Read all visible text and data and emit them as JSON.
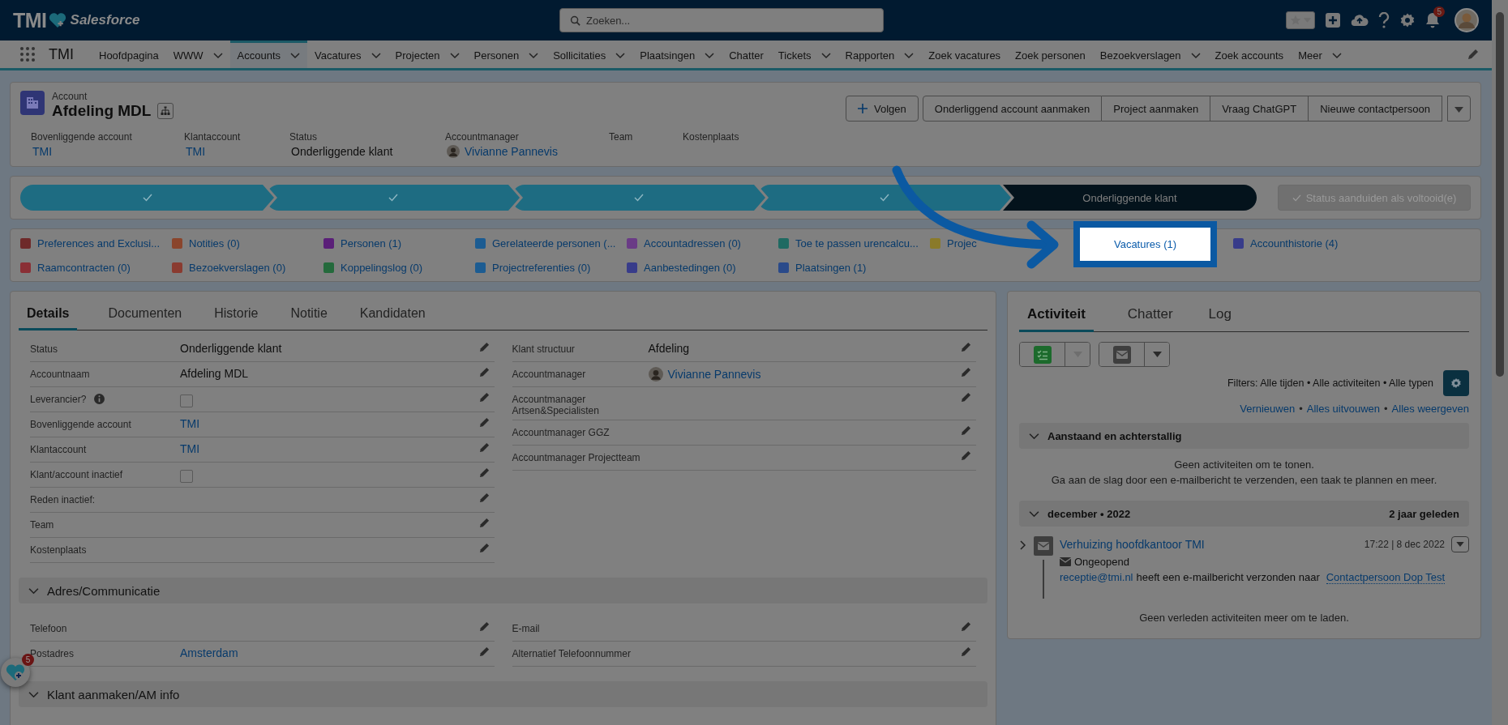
{
  "header": {
    "logo_text": "TMI",
    "brand": "Salesforce",
    "search": {
      "placeholder": "Zoeken..."
    },
    "notifications": "5"
  },
  "nav": {
    "app_name": "TMI",
    "items": [
      {
        "label": "Hoofdpagina",
        "dropdown": false,
        "selected": false
      },
      {
        "label": "WWW",
        "dropdown": true,
        "selected": false
      },
      {
        "label": "Accounts",
        "dropdown": true,
        "selected": true
      },
      {
        "label": "Vacatures",
        "dropdown": true,
        "selected": false
      },
      {
        "label": "Projecten",
        "dropdown": true,
        "selected": false
      },
      {
        "label": "Personen",
        "dropdown": true,
        "selected": false
      },
      {
        "label": "Sollicitaties",
        "dropdown": true,
        "selected": false
      },
      {
        "label": "Plaatsingen",
        "dropdown": true,
        "selected": false
      },
      {
        "label": "Chatter",
        "dropdown": false,
        "selected": false
      },
      {
        "label": "Tickets",
        "dropdown": true,
        "selected": false
      },
      {
        "label": "Rapporten",
        "dropdown": true,
        "selected": false
      },
      {
        "label": "Zoek vacatures",
        "dropdown": false,
        "selected": false
      },
      {
        "label": "Zoek personen",
        "dropdown": false,
        "selected": false
      },
      {
        "label": "Bezoekverslagen",
        "dropdown": true,
        "selected": false
      },
      {
        "label": "Zoek accounts",
        "dropdown": false,
        "selected": false
      },
      {
        "label": "Meer",
        "dropdown": true,
        "selected": false
      }
    ]
  },
  "record": {
    "object": "Account",
    "name": "Afdeling MDL",
    "actions": [
      {
        "kind": "follow",
        "label": "Volgen"
      },
      {
        "kind": "text",
        "label": "Onderliggend account aanmaken"
      },
      {
        "kind": "text",
        "label": "Project aanmaken"
      },
      {
        "kind": "text",
        "label": "Vraag ChatGPT"
      },
      {
        "kind": "text",
        "label": "Nieuwe contactpersoon"
      },
      {
        "kind": "menu"
      }
    ],
    "highlights": [
      {
        "label": "Bovenliggende account",
        "kind": "link",
        "value": "TMI"
      },
      {
        "label": "Klantaccount",
        "kind": "link",
        "value": "TMI"
      },
      {
        "label": "Status",
        "kind": "text",
        "value": "Onderliggende klant"
      },
      {
        "label": "Accountmanager",
        "kind": "user",
        "value": "Vivianne Pannevis"
      },
      {
        "label": "Team"
      },
      {
        "label": "Kostenplaats"
      }
    ]
  },
  "path": {
    "stages": [
      {
        "completed": true
      },
      {
        "completed": true
      },
      {
        "completed": true
      },
      {
        "completed": true
      },
      {
        "completed": false,
        "label": "Onderliggende klant"
      }
    ],
    "button": {
      "label": "Status aanduiden als voltooid(e)",
      "disabled": true
    }
  },
  "related": {
    "items": [
      {
        "label": "Preferences and Exclusi...",
        "color": "#6e2a2a",
        "highlighted": false
      },
      {
        "label": "Notities (0)",
        "color": "#8a452c",
        "highlighted": false
      },
      {
        "label": "Personen (1)",
        "color": "#5a1f78",
        "highlighted": false
      },
      {
        "label": "Gerelateerde personen (...",
        "color": "#1c5c92",
        "highlighted": false
      },
      {
        "label": "Accountadressen (0)",
        "color": "#6a3b86",
        "highlighted": false
      },
      {
        "label": "Toe te passen urencalcu...",
        "color": "#1f6a62",
        "highlighted": false
      },
      {
        "label": "Projec",
        "color": "#8a7a2a",
        "highlighted": false
      },
      {
        "label": "Vacatures (1)",
        "highlighted": true
      },
      {
        "label": "Accounthistorie (4)",
        "color": "#383c8a",
        "highlighted": false
      },
      {
        "label": "Raamcontracten (0)",
        "color": "#8a2f35",
        "highlighted": false
      },
      {
        "label": "Bezoekverslagen (0)",
        "color": "#8a3b30",
        "highlighted": false
      },
      {
        "label": "Koppelingslog (0)",
        "color": "#246a3c",
        "highlighted": false
      },
      {
        "label": "Projectreferenties (0)",
        "color": "#1c5c92",
        "highlighted": false
      },
      {
        "label": "Aanbestedingen (0)",
        "color": "#383c8a",
        "highlighted": false
      },
      {
        "label": "Plaatsingen (1)",
        "color": "#2a4a8a",
        "highlighted": false
      }
    ]
  },
  "details": {
    "tabs": [
      {
        "label": "Details",
        "selected": true
      },
      {
        "label": "Documenten",
        "selected": false
      },
      {
        "label": "Historie",
        "selected": false
      },
      {
        "label": "Notitie",
        "selected": false
      },
      {
        "label": "Kandidaten",
        "selected": false
      }
    ],
    "left": [
      {
        "label": "Status",
        "kind": "text",
        "value": "Onderliggende klant"
      },
      {
        "label": "Accountnaam",
        "kind": "text",
        "value": "Afdeling MDL"
      },
      {
        "label": "Leverancier?",
        "help": true,
        "kind": "checkbox",
        "checked": false
      },
      {
        "label": "Bovenliggende account",
        "kind": "link",
        "value": "TMI"
      },
      {
        "label": "Klantaccount",
        "kind": "link",
        "value": "TMI"
      },
      {
        "label": "Klant/account inactief",
        "kind": "checkbox",
        "checked": false
      },
      {
        "label": "Reden inactief:"
      },
      {
        "label": "Team"
      },
      {
        "label": "Kostenplaats"
      }
    ],
    "right": [
      {
        "label": "Klant structuur",
        "kind": "text",
        "value": "Afdeling"
      },
      {
        "label": "Accountmanager",
        "kind": "user",
        "value": "Vivianne Pannevis"
      },
      {
        "label": "Accountmanager Artsen&Specialisten"
      },
      {
        "label": "Accountmanager GGZ"
      },
      {
        "label": "Accountmanager Projectteam"
      }
    ],
    "sections": [
      {
        "title": "Adres/Communicatie",
        "expanded": true,
        "left": [
          {
            "label": "Telefoon"
          },
          {
            "label": "Postadres",
            "kind": "link",
            "value": "Amsterdam"
          }
        ],
        "right": [
          {
            "label": "E-mail"
          },
          {
            "label": "Alternatief Telefoonnummer"
          }
        ]
      },
      {
        "title": "Klant aanmaken/AM info",
        "expanded": true
      }
    ]
  },
  "activity": {
    "tabs": [
      {
        "label": "Activiteit",
        "selected": true
      },
      {
        "label": "Chatter",
        "selected": false
      },
      {
        "label": "Log",
        "selected": false
      }
    ],
    "buttons": [
      {
        "kind": "task",
        "menu_disabled": true
      },
      {
        "kind": "email",
        "menu_disabled": false
      }
    ],
    "filters": "Filters: Alle tijden • Alle activiteiten • Alle typen",
    "links": [
      "Vernieuwen",
      "Alles uitvouwen",
      "Alles weergeven"
    ],
    "separator": "•",
    "groups": [
      {
        "title": "Aanstaand en achterstallig",
        "expanded": true,
        "empty": [
          "Geen activiteiten om te tonen.",
          "Ga aan de slag door een e-mailbericht te verzenden, een taak te plannen en meer."
        ]
      },
      {
        "title": "december • 2022",
        "when": "2 jaar geleden",
        "expanded": true,
        "items": [
          {
            "expanded": false,
            "title": "Verhuizing hoofdkantoor TMI",
            "time": "17:22 | 8 dec 2022",
            "status": "Ongeopend",
            "sender": "receptie@tmi.nl",
            "action": "heeft een e-mailbericht verzonden naar",
            "recipient": "Contactpersoon Dop Test"
          }
        ]
      }
    ],
    "footer": "Geen verleden activiteiten meer om te laden."
  },
  "helper": {
    "badge": "5"
  }
}
